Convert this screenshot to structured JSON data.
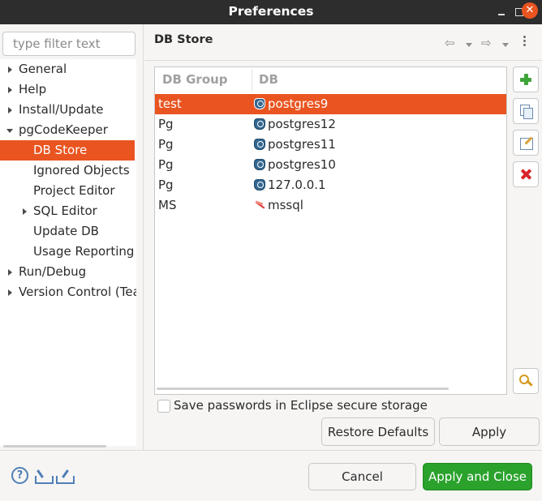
{
  "window": {
    "title": "Preferences",
    "close_glyph": "✕"
  },
  "sidebar": {
    "filter_placeholder": "type filter text",
    "items": [
      {
        "label": "General",
        "has_children": true,
        "expanded": false
      },
      {
        "label": "Help",
        "has_children": true,
        "expanded": false
      },
      {
        "label": "Install/Update",
        "has_children": true,
        "expanded": false
      },
      {
        "label": "pgCodeKeeper",
        "has_children": true,
        "expanded": true
      },
      {
        "label": "DB Store",
        "selected": true
      },
      {
        "label": "Ignored Objects"
      },
      {
        "label": "Project Editor"
      },
      {
        "label": "SQL Editor",
        "has_children": true,
        "expanded": false
      },
      {
        "label": "Update DB"
      },
      {
        "label": "Usage Reporting"
      },
      {
        "label": "Run/Debug",
        "has_children": true,
        "expanded": false
      },
      {
        "label": "Version Control (Tea",
        "has_children": true,
        "expanded": false
      }
    ]
  },
  "page": {
    "title": "DB Store",
    "nav": {
      "back": "⇦",
      "forward": "⇨"
    }
  },
  "table": {
    "columns": [
      "DB Group",
      "DB"
    ],
    "rows": [
      {
        "group": "test",
        "db": "postgres9",
        "icon": "postgresql-icon",
        "selected": true
      },
      {
        "group": "Pg",
        "db": "postgres12",
        "icon": "postgresql-icon"
      },
      {
        "group": "Pg",
        "db": "postgres11",
        "icon": "postgresql-icon"
      },
      {
        "group": "Pg",
        "db": "postgres10",
        "icon": "postgresql-icon"
      },
      {
        "group": "Pg",
        "db": "127.0.0.1",
        "icon": "postgresql-icon"
      },
      {
        "group": "MS",
        "db": "mssql",
        "icon": "mssql-icon"
      }
    ]
  },
  "side_buttons": [
    "add-icon",
    "copy-icon",
    "edit-icon",
    "delete-icon",
    "key-icon"
  ],
  "checkbox": {
    "label": "Save passwords in Eclipse secure storage",
    "checked": false
  },
  "buttons": {
    "restore_defaults": "Restore Defaults",
    "apply": "Apply",
    "cancel": "Cancel",
    "apply_and_close": "Apply and Close"
  },
  "footer": {
    "help_glyph": "?"
  },
  "colors": {
    "selection": "#e95420",
    "primary_button": "#2aa22c",
    "titlebar": "#2d2d2d"
  }
}
